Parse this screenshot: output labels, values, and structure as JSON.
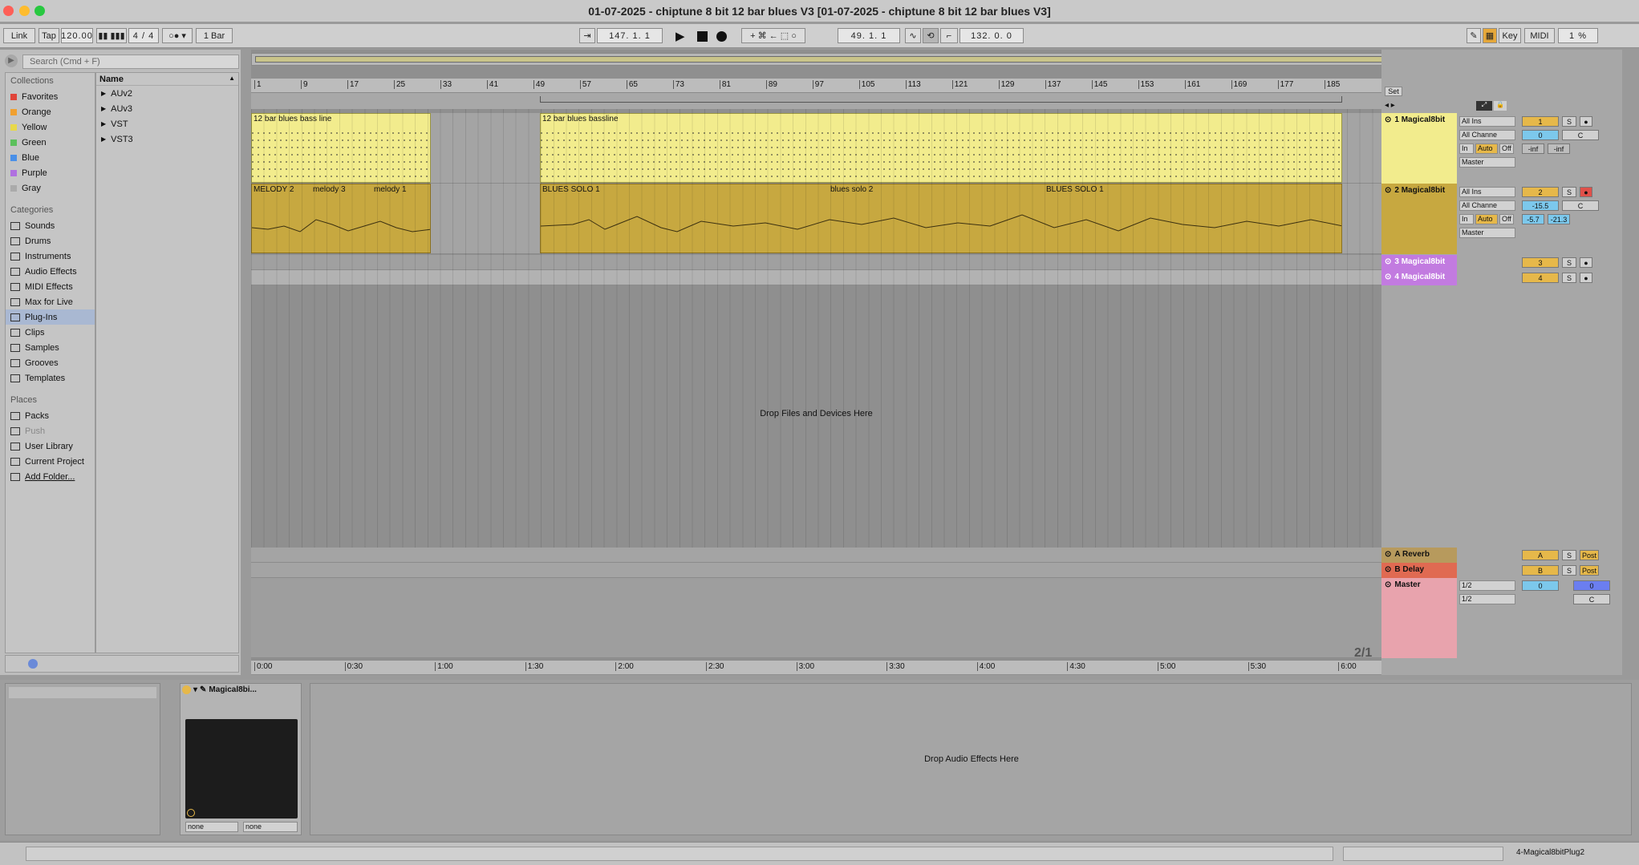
{
  "window": {
    "title": "01-07-2025 - chiptune 8 bit 12 bar blues V3  [01-07-2025 - chiptune 8 bit 12 bar blues V3]"
  },
  "transport": {
    "link": "Link",
    "tap": "Tap",
    "tempo": "120.00",
    "signature": "4 / 4",
    "quantize": "1 Bar",
    "position": "147.   1.   1",
    "loop_start": "49.   1.   1",
    "loop_length": "132.   0.   0",
    "key": "Key",
    "midi": "MIDI",
    "cpu": "1 %"
  },
  "browser": {
    "search_placeholder": "Search (Cmd + F)",
    "collections_title": "Collections",
    "collections": [
      {
        "label": "Favorites",
        "color": "#e0443a"
      },
      {
        "label": "Orange",
        "color": "#f0a030"
      },
      {
        "label": "Yellow",
        "color": "#e8d84a"
      },
      {
        "label": "Green",
        "color": "#5cc05c"
      },
      {
        "label": "Blue",
        "color": "#4a90e8"
      },
      {
        "label": "Purple",
        "color": "#b070e0"
      },
      {
        "label": "Gray",
        "color": "#aaaaaa"
      }
    ],
    "categories_title": "Categories",
    "categories": [
      "Sounds",
      "Drums",
      "Instruments",
      "Audio Effects",
      "MIDI Effects",
      "Max for Live",
      "Plug-Ins",
      "Clips",
      "Samples",
      "Grooves",
      "Templates"
    ],
    "selected_category": "Plug-Ins",
    "places_title": "Places",
    "places": [
      "Packs",
      "Push",
      "User Library",
      "Current Project",
      "Add Folder..."
    ],
    "name_header": "Name",
    "items": [
      "AUv2",
      "AUv3",
      "VST",
      "VST3"
    ]
  },
  "arrangement": {
    "bar_labels": [
      "1",
      "9",
      "17",
      "25",
      "33",
      "41",
      "49",
      "57",
      "65",
      "73",
      "81",
      "89",
      "97",
      "105",
      "113",
      "121",
      "129",
      "137",
      "145",
      "153",
      "161",
      "169",
      "177",
      "185"
    ],
    "time_labels": [
      "0:00",
      "0:30",
      "1:00",
      "1:30",
      "2:00",
      "2:30",
      "3:00",
      "3:30",
      "4:00",
      "4:30",
      "5:00",
      "5:30",
      "6:00"
    ],
    "drop_text": "Drop Files and Devices Here",
    "zoom_label": "2/1",
    "clips_track1": [
      "12 bar blues bass line",
      "12 bar blues bassline"
    ],
    "clips_track2": [
      "MELODY 2",
      "melody 3",
      "melody 1",
      "BLUES SOLO 1",
      "blues solo 2",
      "BLUES SOLO 1"
    ]
  },
  "mixer": {
    "set_label": "Set",
    "tracks": [
      {
        "name": "1 Magical8bit",
        "input": "All Ins",
        "channel": "All Channe",
        "num": "1",
        "vol": "0",
        "pan": "C",
        "l": "-inf",
        "r": "-inf",
        "out": "Master",
        "mon": [
          "In",
          "Auto",
          "Off"
        ],
        "solo": "S"
      },
      {
        "name": "2 Magical8bit",
        "input": "All Ins",
        "channel": "All Channe",
        "num": "2",
        "vol": "-15.5",
        "pan": "C",
        "l": "-5.7",
        "r": "-21.3",
        "out": "Master",
        "mon": [
          "In",
          "Auto",
          "Off"
        ],
        "solo": "S"
      },
      {
        "name": "3 Magical8bit",
        "num": "3",
        "solo": "S"
      },
      {
        "name": "4 Magical8bit",
        "num": "4",
        "solo": "S"
      }
    ],
    "returns": [
      {
        "name": "A Reverb",
        "letter": "A",
        "solo": "S",
        "post": "Post"
      },
      {
        "name": "B Delay",
        "letter": "B",
        "solo": "S",
        "post": "Post"
      }
    ],
    "master": {
      "name": "Master",
      "vol": "0",
      "pan": "C",
      "sel1": "1/2",
      "sel2": "1/2",
      "val": "0"
    }
  },
  "device": {
    "name": "Magical8bi...",
    "sel1": "none",
    "sel2": "none",
    "drop_text": "Drop Audio Effects Here"
  },
  "status": {
    "right": "4-Magical8bitPlug2"
  },
  "colors": {
    "clip_yellow": "#f2ec8d",
    "clip_gold": "#c7a840",
    "return_a": "#b79a5d",
    "return_b": "#e06a52",
    "master": "#e8a3ad",
    "track_purple": "#c27be0"
  }
}
